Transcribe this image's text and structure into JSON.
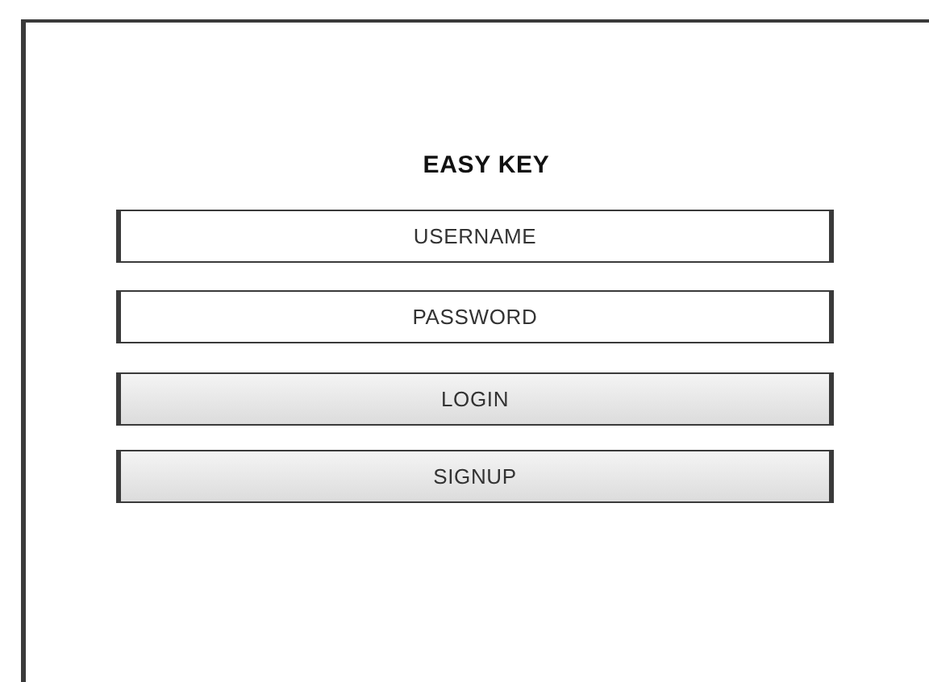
{
  "title": "EASY KEY",
  "fields": [
    {
      "placeholder": "USERNAME"
    },
    {
      "placeholder": "PASSWORD"
    }
  ],
  "buttons": [
    "LOGIN",
    "SIGNUP"
  ]
}
